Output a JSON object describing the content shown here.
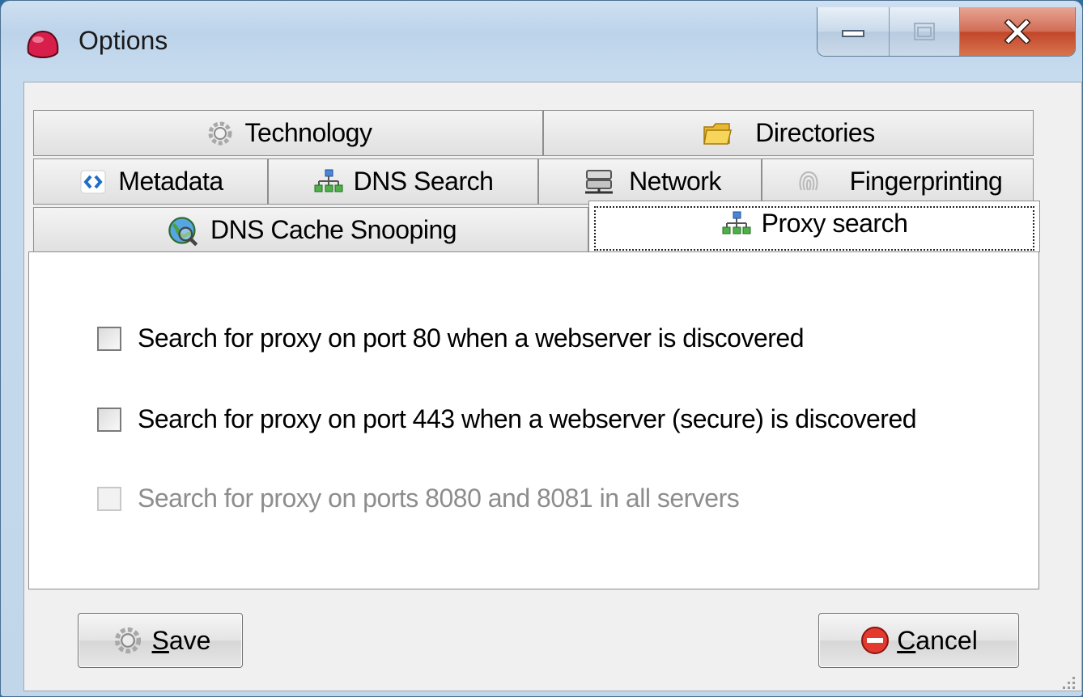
{
  "window": {
    "title": "Options"
  },
  "tabs": {
    "row1": [
      {
        "label": "Technology",
        "icon": "gear-icon"
      },
      {
        "label": "Directories",
        "icon": "folder-icon"
      }
    ],
    "row2": [
      {
        "label": "Metadata",
        "icon": "code-icon"
      },
      {
        "label": "DNS Search",
        "icon": "network-tree-icon"
      },
      {
        "label": "Network",
        "icon": "server-icon"
      },
      {
        "label": "Fingerprinting",
        "icon": "fingerprint-icon"
      }
    ],
    "row3": [
      {
        "label": "DNS Cache Snooping",
        "icon": "globe-magnifier-icon"
      },
      {
        "label": "Proxy search",
        "icon": "network-tree-icon",
        "selected": true
      }
    ]
  },
  "proxy_panel": {
    "options": [
      {
        "label": "Search for proxy on port 80 when a webserver is discovered",
        "checked": false,
        "enabled": true
      },
      {
        "label": "Search for proxy on port 443 when a webserver (secure) is discovered",
        "checked": false,
        "enabled": true
      },
      {
        "label": "Search for proxy on ports 8080 and 8081 in all servers",
        "checked": false,
        "enabled": false
      }
    ]
  },
  "buttons": {
    "save": {
      "mnemonic": "S",
      "rest": "ave",
      "icon": "gear-icon"
    },
    "cancel": {
      "mnemonic": "C",
      "rest": "ancel",
      "icon": "cancel-icon"
    }
  },
  "colors": {
    "title_bar": "#c7dbee",
    "client_bg": "#f0f0f0",
    "close_button": "#c2462a",
    "disabled_text": "#8d8d8d"
  }
}
